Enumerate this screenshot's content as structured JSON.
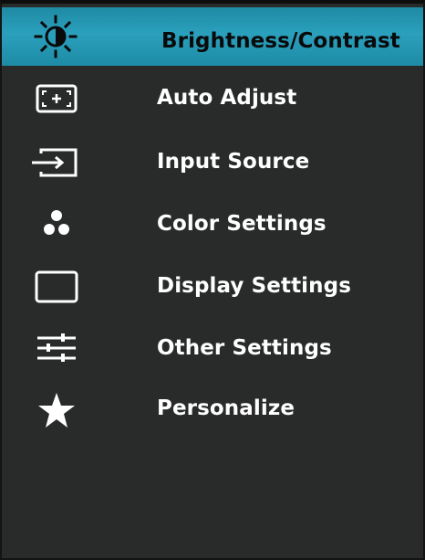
{
  "menu": {
    "items": [
      {
        "label": "Brightness/Contrast",
        "icon": "brightness-icon",
        "selected": true
      },
      {
        "label": "Auto Adjust",
        "icon": "auto-adjust-icon",
        "selected": false
      },
      {
        "label": "Input Source",
        "icon": "input-source-icon",
        "selected": false
      },
      {
        "label": "Color Settings",
        "icon": "color-settings-icon",
        "selected": false
      },
      {
        "label": "Display Settings",
        "icon": "display-settings-icon",
        "selected": false
      },
      {
        "label": "Other Settings",
        "icon": "sliders-icon",
        "selected": false
      },
      {
        "label": "Personalize",
        "icon": "star-icon",
        "selected": false
      }
    ]
  },
  "colors": {
    "highlight": "#2aa0bd",
    "background": "#292b2b",
    "text": "#ffffff",
    "selected_text": "#0a0a0a"
  }
}
